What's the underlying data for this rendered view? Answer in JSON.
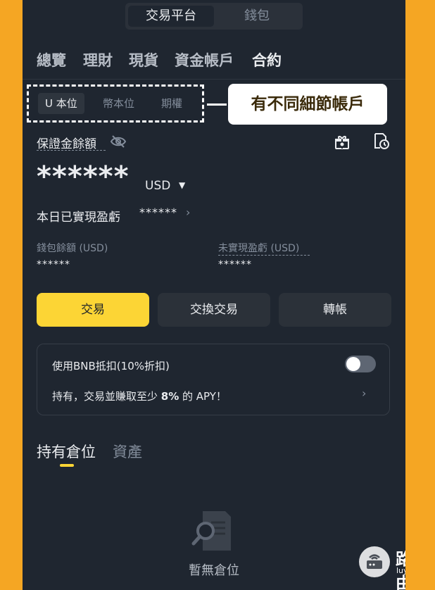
{
  "top_switch": {
    "active": "交易平台",
    "inactive": "錢包"
  },
  "main_tabs": [
    {
      "label": "總覽"
    },
    {
      "label": "理財"
    },
    {
      "label": "現貨"
    },
    {
      "label": "資金帳戶"
    },
    {
      "label": "合約",
      "active": true
    }
  ],
  "sub_tabs": [
    {
      "label": "U 本位",
      "active": true
    },
    {
      "label": "幣本位"
    },
    {
      "label": "期權"
    }
  ],
  "callout": "有不同細節帳戶",
  "margin": {
    "label": "保證金餘額",
    "masked_value": "******",
    "unit": "USD",
    "icons": [
      "eye-hidden-icon",
      "gift-icon",
      "history-icon"
    ]
  },
  "pnl": {
    "label": "本日已實現盈虧",
    "value": "******"
  },
  "wallet_balance": {
    "label": "錢包餘額 (USD)",
    "value": "******"
  },
  "unrealized_pnl": {
    "label": "未實現盈虧 (USD)",
    "value": "******"
  },
  "buttons": {
    "trade": "交易",
    "convert": "交換交易",
    "transfer": "轉帳"
  },
  "bnb_card": {
    "deduct_label": "使用BNB抵扣(10%折扣)",
    "toggle_on": false,
    "apy_prefix": "持有，交易並賺取至少 ",
    "apy_bold": "8%",
    "apy_suffix": " 的 APY！"
  },
  "position_tabs": {
    "positions": "持有倉位",
    "assets": "資產"
  },
  "empty_state": "暫無倉位",
  "watermark": {
    "title": "路由器",
    "subtitle": "luyouqi.com"
  },
  "colors": {
    "frame": "#f5a623",
    "background": "#1f2630",
    "accent": "#fcd535"
  }
}
